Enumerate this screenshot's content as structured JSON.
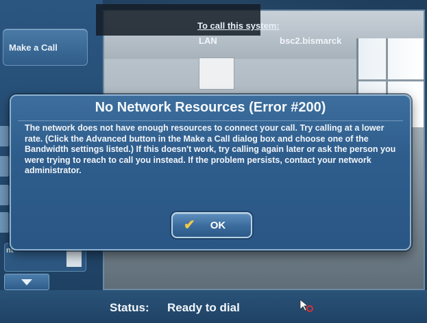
{
  "sidebar": {
    "make_call_label": "Make a Call",
    "partial_label": "nt"
  },
  "video": {
    "to_call_heading": "To call this system:",
    "network_label": "LAN",
    "system_address": "bsc2.bismarck"
  },
  "dialog": {
    "title": "No Network Resources (Error #200)",
    "message": "The network does not have enough resources to connect your call.  Try calling at a lower rate. (Click the Advanced button in the Make a Call dialog box and choose one of the Bandwidth settings listed.) If this doesn't work, try calling again later or ask the person you were trying to reach to call you instead. If the problem persists, contact your network administrator.",
    "ok_label": "OK",
    "ok_icon": "checkmark-icon"
  },
  "status": {
    "label": "Status:",
    "value": "Ready to dial"
  },
  "colors": {
    "panel_blue": "#2e5d8c",
    "check_yellow": "#f2c94c",
    "cursor_red": "#d8303a"
  }
}
